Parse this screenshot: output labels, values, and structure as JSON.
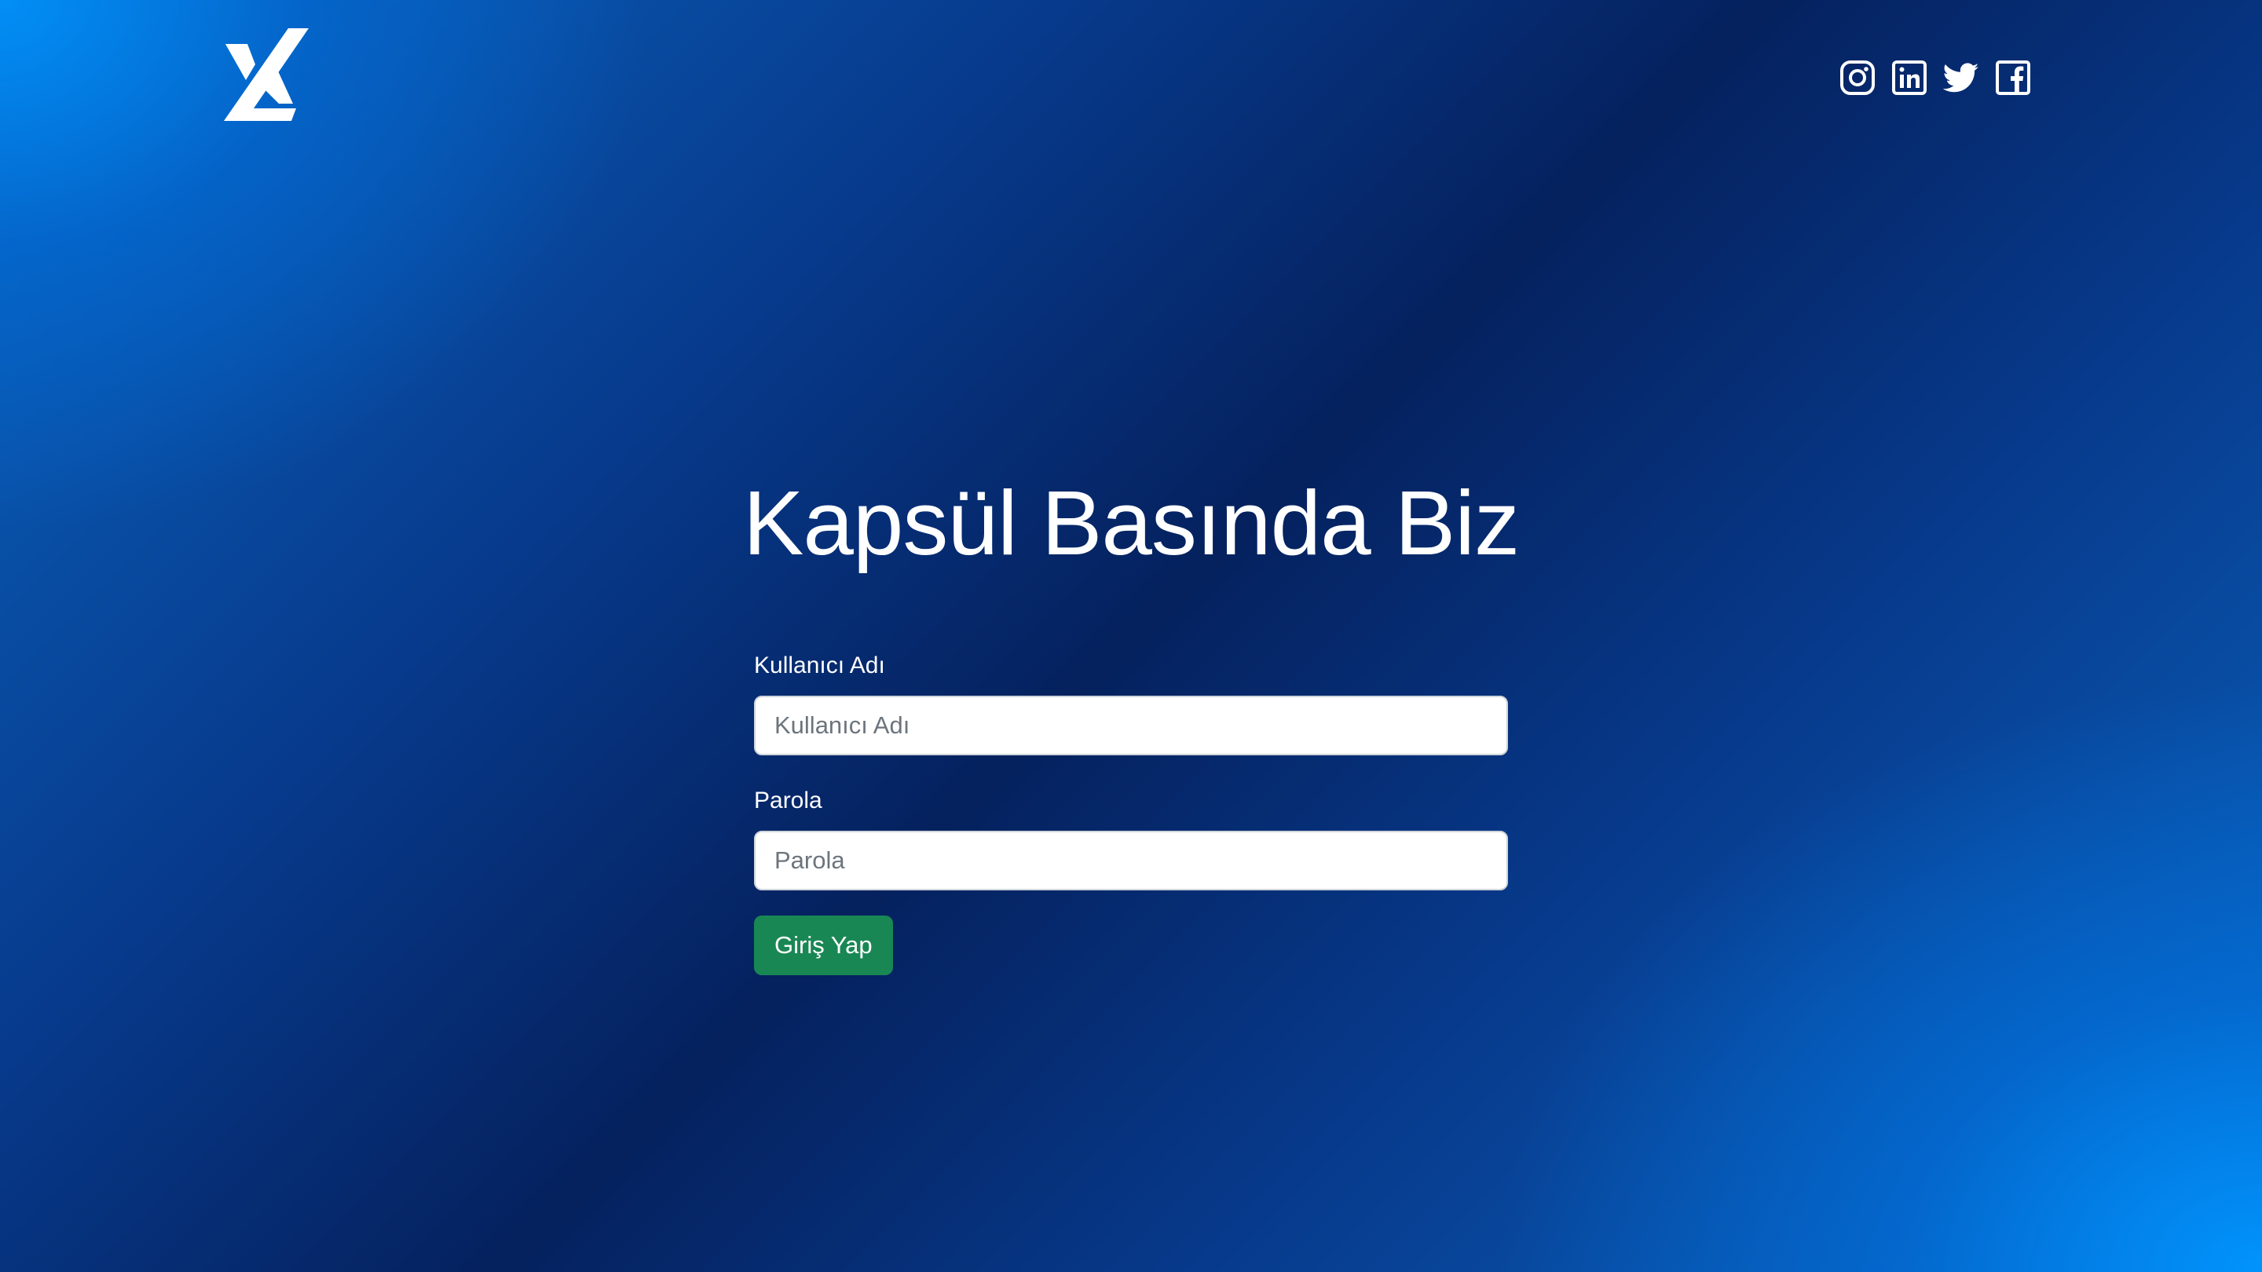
{
  "header": {
    "logo_icon": "stylized-x-logo-icon",
    "social_icons": [
      "instagram-icon",
      "linkedin-icon",
      "twitter-icon",
      "facebook-icon"
    ]
  },
  "main": {
    "title": "Kapsül Basında Biz"
  },
  "login_form": {
    "username_label": "Kullanıcı Adı",
    "username_placeholder": "Kullanıcı Adı",
    "username_value": "",
    "password_label": "Parola",
    "password_placeholder": "Parola",
    "password_value": "",
    "submit_label": "Giriş Yap"
  },
  "colors": {
    "background_dark": "#05215e",
    "background_light": "#0096ff",
    "button": "#198754",
    "text": "#ffffff"
  }
}
